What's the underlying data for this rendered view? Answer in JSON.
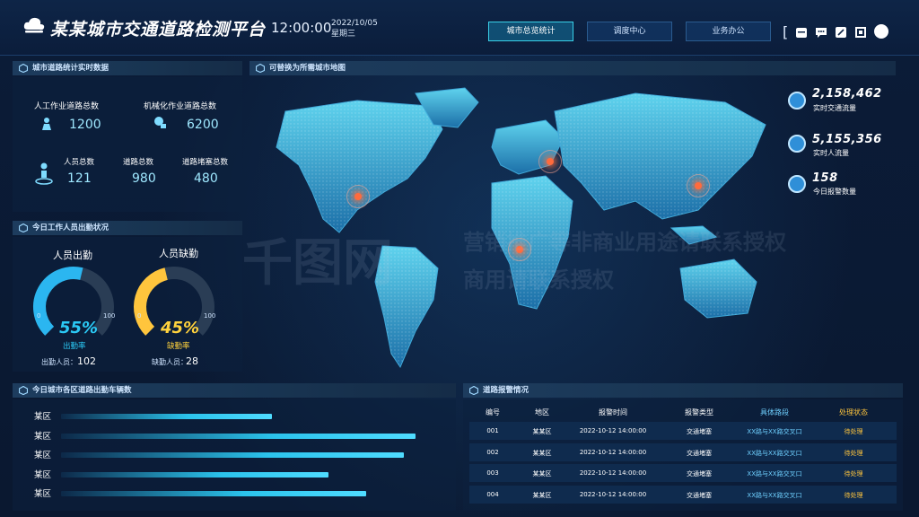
{
  "header": {
    "title": "某某城市交通道路检测平台",
    "time": "12:00:00",
    "date": "2022/10/05",
    "weekday": "星期三",
    "nav": [
      {
        "label": "城市总览统计",
        "active": true
      },
      {
        "label": "调度中心",
        "active": false
      },
      {
        "label": "业务办公",
        "active": false
      }
    ],
    "tools": [
      "calendar-icon",
      "chat-icon",
      "edit-icon",
      "fullscreen-icon",
      "user-icon"
    ],
    "bracket": "["
  },
  "stats": {
    "title": "城市道路统计实时数据",
    "manual_label": "人工作业道路总数",
    "manual_value": "1200",
    "mech_label": "机械化作业道路总数",
    "mech_value": "6200",
    "staff_label": "人员总数",
    "staff_value": "121",
    "road_label": "道路总数",
    "road_value": "980",
    "jam_label": "道路堵塞总数",
    "jam_value": "480"
  },
  "attendance": {
    "title": "今日工作人员出勤状况",
    "present": {
      "title": "人员出勤",
      "pct": "55%",
      "sub": "出勤率",
      "min": "0",
      "max": "100",
      "count_label": "出勤人员：",
      "count": "102",
      "value": 0.55,
      "color": "#2bb6f0"
    },
    "absent": {
      "title": "人员缺勤",
      "pct": "45%",
      "sub": "缺勤率",
      "min": "0",
      "max": "100",
      "count_label": "缺勤人员：",
      "count": "28",
      "value": 0.45,
      "color": "#ffc53d"
    }
  },
  "map": {
    "title": "可替换为所需城市地图",
    "kpis": [
      {
        "value": "2,158,462",
        "label": "实时交通流量"
      },
      {
        "value": "5,155,356",
        "label": "实时人流量"
      },
      {
        "value": "158",
        "label": "今日报警数量"
      }
    ],
    "watermark_1": "营销推广等非商业用途请联系授权",
    "watermark_2": "商用请联系授权",
    "watermark_logo": "千图网"
  },
  "vehicles": {
    "title": "今日城市各区道路出勤车辆数",
    "chart_data": {
      "type": "bar",
      "categories": [
        "某区",
        "某区",
        "某区",
        "某区",
        "某区"
      ],
      "values": [
        0.56,
        0.94,
        0.91,
        0.71,
        0.81
      ]
    }
  },
  "alerts": {
    "title": "道路报警情况",
    "columns": [
      "编号",
      "地区",
      "报警时间",
      "报警类型",
      "具体路段",
      "处理状态"
    ],
    "rows": [
      [
        "001",
        "某某区",
        "2022-10-12 14:00:00",
        "交通堵塞",
        "XX路与XX路交叉口",
        "待处理"
      ],
      [
        "002",
        "某某区",
        "2022-10-12 14:00:00",
        "交通堵塞",
        "XX路与XX路交叉口",
        "待处理"
      ],
      [
        "003",
        "某某区",
        "2022-10-12 14:00:00",
        "交通堵塞",
        "XX路与XX路交叉口",
        "待处理"
      ],
      [
        "004",
        "某某区",
        "2022-10-12 14:00:00",
        "交通堵塞",
        "XX路与XX路交叉口",
        "待处理"
      ]
    ]
  },
  "colors": {
    "accent_cyan": "#39d0e8",
    "present": "#2bb6f0",
    "absent": "#ffc53d",
    "alert_dot": "#ff6b3d"
  }
}
